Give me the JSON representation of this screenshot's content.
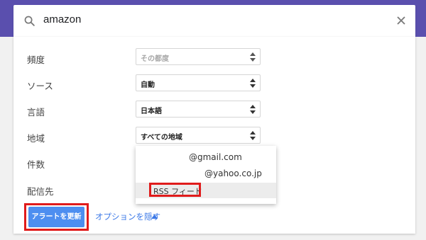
{
  "search": {
    "value": "amazon"
  },
  "fields": {
    "frequency": {
      "label": "頻度",
      "value": "その都度"
    },
    "source": {
      "label": "ソース",
      "value": "自動"
    },
    "language": {
      "label": "言語",
      "value": "日本語"
    },
    "region": {
      "label": "地域",
      "value": "すべての地域"
    },
    "count": {
      "label": "件数"
    },
    "delivery": {
      "label": "配信先"
    }
  },
  "delivery_menu": {
    "options": [
      "@gmail.com",
      "@yahoo.co.jp",
      "RSS フィード"
    ],
    "highlighted": "RSS フィード"
  },
  "actions": {
    "update_label": "アラートを更新",
    "options_label": "オプションを隠す"
  },
  "colors": {
    "header": "#5a4fae",
    "primary_button": "#4d8ef0",
    "link": "#3b78e7",
    "annotation": "#e01b1b"
  },
  "icons": [
    "search-icon",
    "close-icon",
    "select-arrows-icon",
    "caret-up-icon"
  ]
}
